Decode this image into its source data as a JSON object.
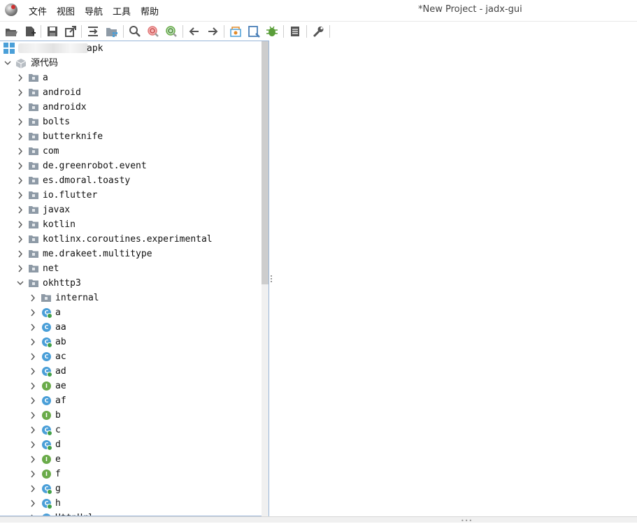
{
  "window": {
    "title": "*New Project - jadx-gui",
    "menu": [
      "文件",
      "视图",
      "导航",
      "工具",
      "帮助"
    ]
  },
  "toolbar": {
    "buttons": [
      "open-file-icon",
      "add-file-icon",
      "save-icon",
      "export-icon",
      "sync-icon",
      "flatten-packages-icon",
      "search-icon",
      "find-class-icon",
      "find-usage-icon",
      "back-icon",
      "forward-icon",
      "deobfuscation-icon",
      "quark-icon",
      "debugger-icon",
      "log-icon",
      "preferences-icon"
    ]
  },
  "tree": {
    "root_label": "apk",
    "source_label": "源代码",
    "packages": [
      "a",
      "android",
      "androidx",
      "bolts",
      "butterknife",
      "com",
      "de.greenrobot.event",
      "es.dmoral.toasty",
      "io.flutter",
      "javax",
      "kotlin",
      "kotlinx.coroutines.experimental",
      "me.drakeet.multitype",
      "net",
      "okhttp3"
    ],
    "okhttp3_children": [
      {
        "label": "internal",
        "kind": "package"
      },
      {
        "label": "a",
        "kind": "class",
        "badge": true
      },
      {
        "label": "aa",
        "kind": "class",
        "badge": false
      },
      {
        "label": "ab",
        "kind": "class",
        "badge": true
      },
      {
        "label": "ac",
        "kind": "class",
        "badge": false
      },
      {
        "label": "ad",
        "kind": "class",
        "badge": true
      },
      {
        "label": "ae",
        "kind": "interface",
        "badge": false
      },
      {
        "label": "af",
        "kind": "class",
        "badge": false
      },
      {
        "label": "b",
        "kind": "interface",
        "badge": false
      },
      {
        "label": "c",
        "kind": "class",
        "badge": true
      },
      {
        "label": "d",
        "kind": "class",
        "badge": true
      },
      {
        "label": "e",
        "kind": "interface",
        "badge": false
      },
      {
        "label": "f",
        "kind": "interface",
        "badge": false
      },
      {
        "label": "g",
        "kind": "class",
        "badge": true
      },
      {
        "label": "h",
        "kind": "class",
        "badge": true
      },
      {
        "label": "HttpUrl",
        "kind": "class",
        "badge": false
      }
    ],
    "class_letter": "C",
    "interface_letter": "I"
  },
  "colors": {
    "class_icon": "#4a9fd8",
    "interface_icon": "#6aab4a",
    "badge": "#43a047",
    "folder": "#8e9aa6",
    "pane_border": "#9ab6d8"
  }
}
